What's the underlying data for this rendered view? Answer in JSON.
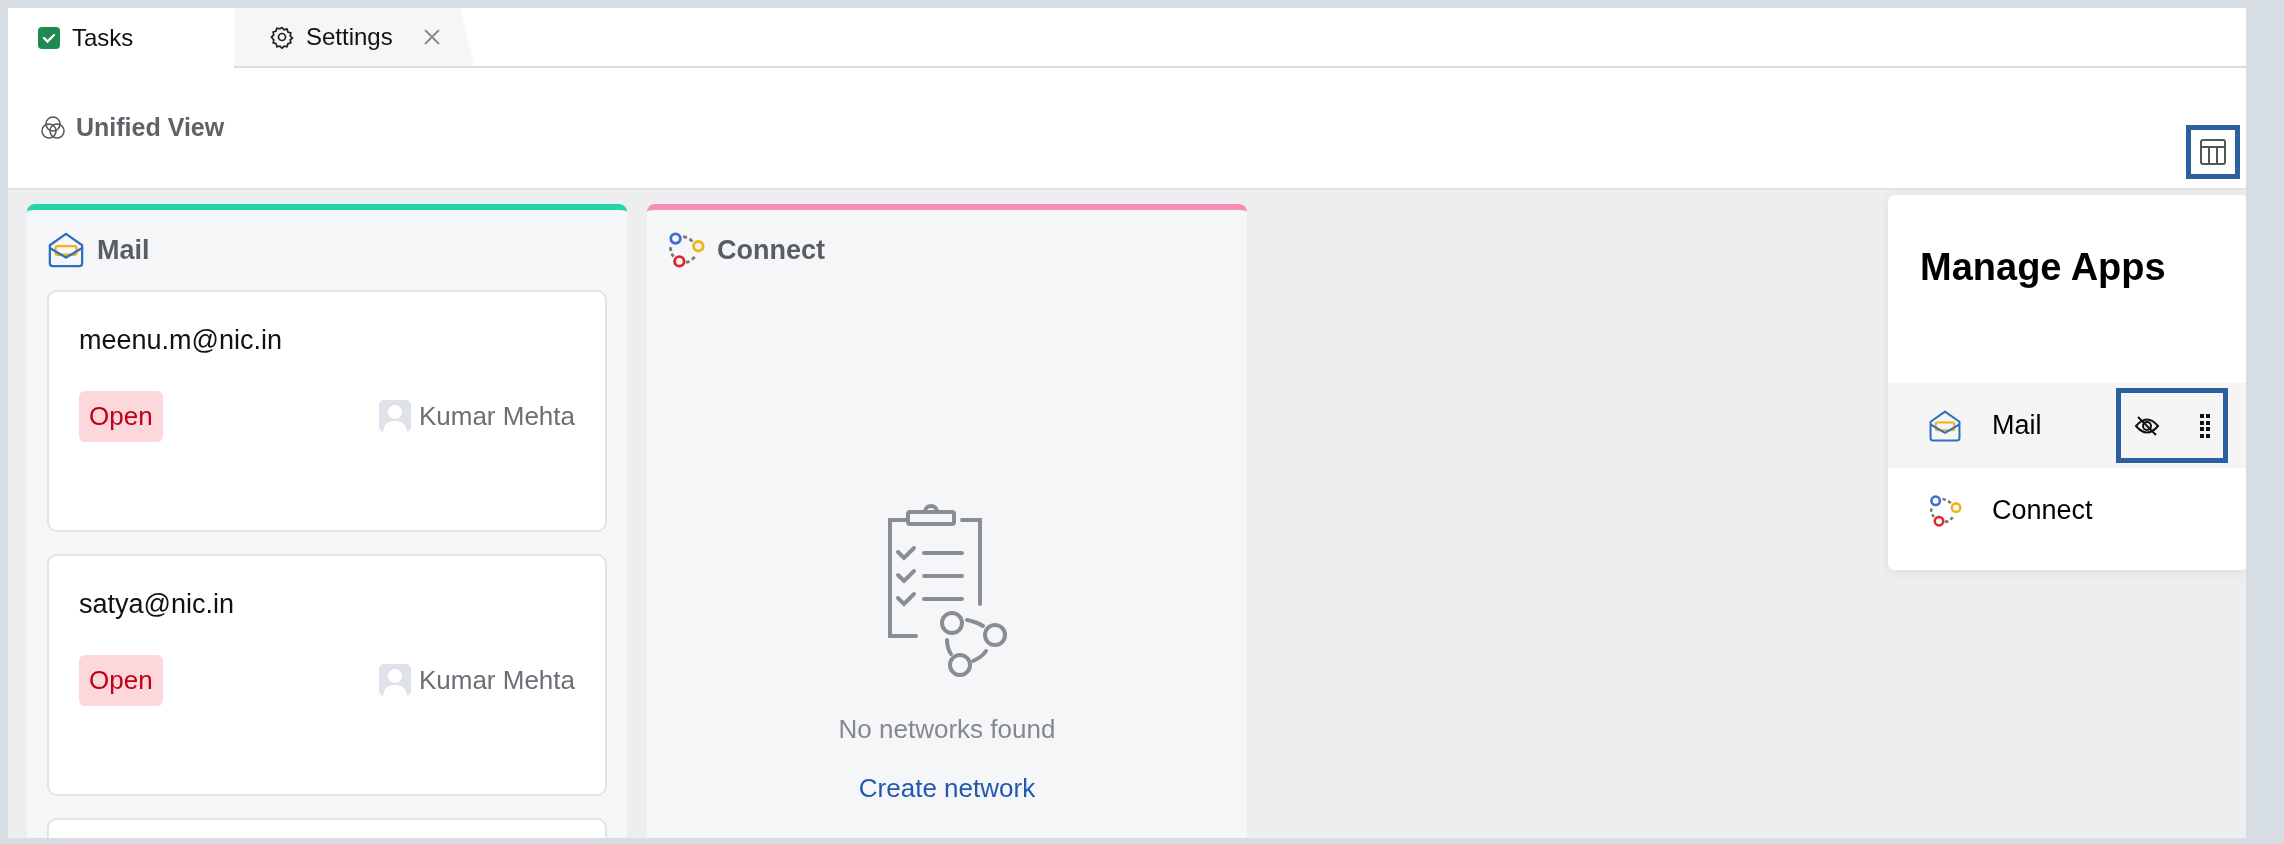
{
  "tabs": [
    {
      "label": "Tasks",
      "kind": "tasks",
      "selected": true,
      "closable": false
    },
    {
      "label": "Settings",
      "kind": "settings",
      "selected": false,
      "closable": true
    }
  ],
  "header": {
    "title": "Unified View",
    "layout_button_highlighted": true
  },
  "columns": [
    {
      "title": "Mail",
      "kind": "mail",
      "color": "#27d3a9",
      "cards": [
        {
          "kind": "task",
          "email": "meenu.m@nic.in",
          "status": "Open",
          "assignee": "Kumar Mehta"
        },
        {
          "kind": "task",
          "email": "satya@nic.in",
          "status": "Open",
          "assignee": "Kumar Mehta"
        },
        {
          "kind": "partial"
        }
      ]
    },
    {
      "title": "Connect",
      "kind": "connect",
      "color": "#fb8cb6",
      "empty_state": {
        "message": "No networks found",
        "action": "Create network"
      }
    }
  ],
  "manage_apps": {
    "title": "Manage Apps",
    "apps": [
      {
        "name": "Mail",
        "kind": "mail",
        "selected": true,
        "highlighted": true
      },
      {
        "name": "Connect",
        "kind": "connect",
        "selected": false,
        "highlighted": false
      }
    ]
  }
}
